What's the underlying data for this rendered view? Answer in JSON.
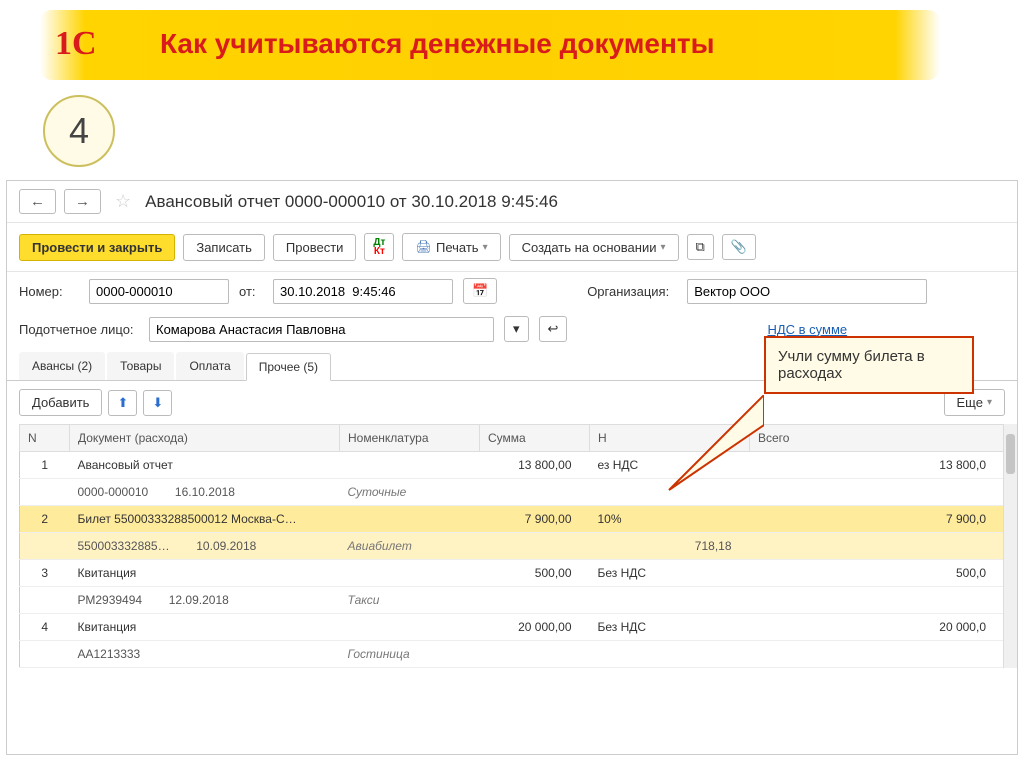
{
  "slide": {
    "title": "Как учитываются денежные документы",
    "step": "4",
    "logo": "1С"
  },
  "window": {
    "title": "Авансовый отчет 0000-000010 от 30.10.2018 9:45:46"
  },
  "toolbar": {
    "post_close": "Провести и закрыть",
    "save": "Записать",
    "post": "Провести",
    "print": "Печать",
    "create_based": "Создать на основании"
  },
  "form": {
    "number_label": "Номер:",
    "number_value": "0000-000010",
    "from_label": "от:",
    "date_value": "30.10.2018  9:45:46",
    "org_label": "Организация:",
    "org_value": "Вектор ООО",
    "person_label": "Подотчетное лицо:",
    "person_value": "Комарова Анастасия Павловна",
    "vat_link": "НДС в сумме"
  },
  "tabs": {
    "t0": "Авансы (2)",
    "t1": "Товары",
    "t2": "Оплата",
    "t3": "Прочее (5)"
  },
  "subtoolbar": {
    "add": "Добавить",
    "more": "Еще"
  },
  "grid": {
    "headers": {
      "n": "N",
      "doc": "Документ (расхода)",
      "nom": "Номенклатура",
      "sum": "Сумма",
      "vat": "Н",
      "total": "Всего"
    },
    "rows": [
      {
        "n": "1",
        "doc_top": "Авансовый отчет",
        "doc_code": "0000-000010",
        "doc_date": "16.10.2018",
        "nom": "Суточные",
        "sum": "13 800,00",
        "vat": "ез НДС",
        "vat_amount": "",
        "total": "13 800,0",
        "selected": false
      },
      {
        "n": "2",
        "doc_top": "Билет 55000333288500012 Москва-С…",
        "doc_code": "550003332885…",
        "doc_date": "10.09.2018",
        "nom": "Авиабилет",
        "sum": "7 900,00",
        "vat": "10%",
        "vat_amount": "718,18",
        "total": "7 900,0",
        "selected": true
      },
      {
        "n": "3",
        "doc_top": "Квитанция",
        "doc_code": "РМ2939494",
        "doc_date": "12.09.2018",
        "nom": "Такси",
        "sum": "500,00",
        "vat": "Без НДС",
        "vat_amount": "",
        "total": "500,0",
        "selected": false
      },
      {
        "n": "4",
        "doc_top": "Квитанция",
        "doc_code": "АА1213333",
        "doc_date": "",
        "nom": "Гостиница",
        "sum": "20 000,00",
        "vat": "Без НДС",
        "vat_amount": "",
        "total": "20 000,0",
        "selected": false
      }
    ]
  },
  "callout": {
    "text": "Учли сумму билета в расходах"
  }
}
